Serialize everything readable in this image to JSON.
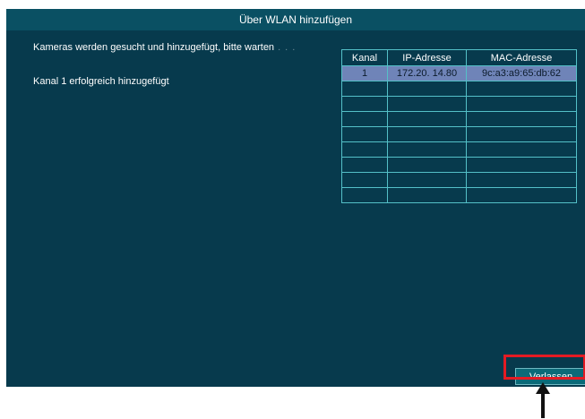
{
  "window": {
    "title": "Über WLAN hinzufügen"
  },
  "status": {
    "searching": "Kameras werden gesucht und hinzugefügt, bitte warten",
    "progress_dots": ". . .",
    "added": "Kanal 1 erfolgreich hinzugefügt"
  },
  "table": {
    "headers": [
      "Kanal",
      "IP-Adresse",
      "MAC-Adresse"
    ],
    "rows": [
      {
        "channel": "1",
        "ip": "172.20. 14.80",
        "mac": "9c:a3:a9:65:db:62"
      }
    ],
    "empty_row_count": 8
  },
  "buttons": {
    "exit_label": "Verlassen"
  },
  "colors": {
    "background": "#073a4d",
    "title_bar": "#0a5063",
    "grid_lines": "#54c0c8",
    "selected_row": "#6f84b8",
    "highlight": "#e31b23"
  },
  "annotations": {
    "arrow_icon": "arrow-up-icon"
  }
}
